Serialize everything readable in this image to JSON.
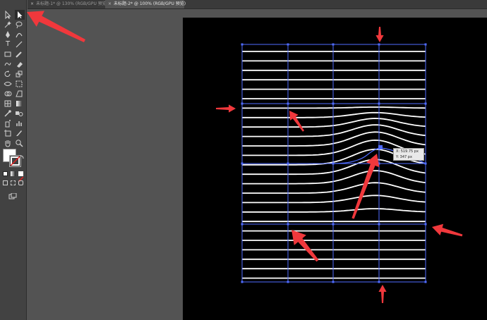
{
  "tabs": [
    {
      "close": "×",
      "label": "未标题-1* @ 130% (RGB/GPU 预览)"
    },
    {
      "close": "×",
      "label": "未标题-2* @ 100% (RGB/GPU 预览)"
    }
  ],
  "active_tab": 1,
  "readout": {
    "x": "X: 519.75 px",
    "y": "Y: 347 px"
  },
  "colors": {
    "ui_bg": "#535353",
    "toolbar": "#424242",
    "artboard": "#000000",
    "mesh_line": "#ffffff",
    "guide": "#4f6bff",
    "annotation_arrow": "#f0383c",
    "fill_swatch": "#ffffff",
    "stroke_swatch": "#e02020"
  },
  "tools": [
    "selection-tool",
    "direct-selection-tool",
    "magic-wand-tool",
    "lasso-tool",
    "pen-tool",
    "curvature-tool",
    "type-tool",
    "line-tool",
    "rectangle-tool",
    "paintbrush-tool",
    "shaper-tool",
    "eraser-tool",
    "rotate-tool",
    "scale-tool",
    "width-tool",
    "free-transform-tool",
    "shape-builder-tool",
    "perspective-tool",
    "mesh-tool",
    "gradient-tool",
    "eyedropper-tool",
    "blend-tool",
    "symbol-sprayer-tool",
    "graph-tool",
    "artboard-tool",
    "slice-tool",
    "hand-tool",
    "zoom-tool",
    "fill-stroke-swatch",
    "drawing-modes",
    "screen-mode"
  ]
}
